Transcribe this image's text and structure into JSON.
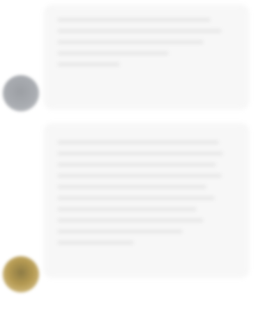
{
  "messages": [
    {
      "text": "",
      "time": ""
    },
    {
      "text": "",
      "time": ""
    }
  ]
}
